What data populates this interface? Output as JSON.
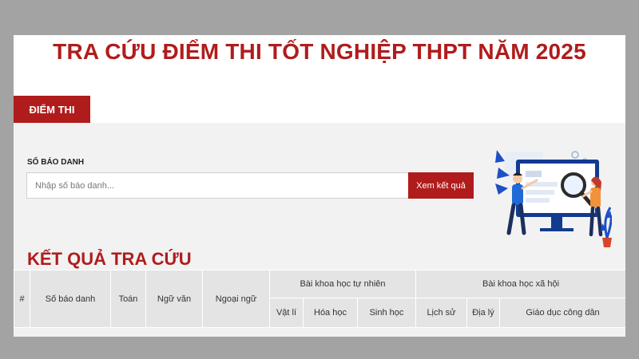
{
  "header": {
    "title": "TRA CỨU ĐIỂM THI TỐT NGHIỆP THPT NĂM 2025"
  },
  "tabs": [
    {
      "label": "ĐIỂM THI",
      "active": true
    }
  ],
  "search": {
    "label": "SỐ BÁO DANH",
    "placeholder": "Nhập số báo danh...",
    "value": "",
    "button_label": "Xem kết quả"
  },
  "results": {
    "title": "KẾT QUẢ TRA CỨU",
    "group_headers": {
      "natural_sciences": "Bài khoa học tự nhiên",
      "social_sciences": "Bài khoa học xã hội"
    },
    "columns": [
      "#",
      "Số báo danh",
      "Toán",
      "Ngữ văn",
      "Ngoại ngữ",
      "Vật lí",
      "Hóa học",
      "Sinh học",
      "Lịch sử",
      "Địa lý",
      "Giáo dục công dân"
    ],
    "rows": []
  },
  "colors": {
    "brand_red": "#b01c1c",
    "panel_bg": "#f2f2f2",
    "table_header_bg": "#e4e4e4",
    "outer_bg": "#a3a3a3"
  }
}
